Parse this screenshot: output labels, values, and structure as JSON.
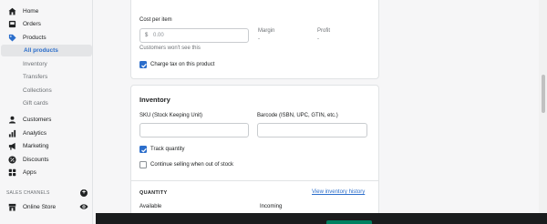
{
  "sidebar": {
    "items": [
      {
        "label": "Home",
        "icon": "home-icon"
      },
      {
        "label": "Orders",
        "icon": "orders-icon"
      },
      {
        "label": "Products",
        "icon": "tag-icon"
      },
      {
        "label": "All products",
        "active": true
      },
      {
        "label": "Inventory"
      },
      {
        "label": "Transfers"
      },
      {
        "label": "Collections"
      },
      {
        "label": "Gift cards"
      },
      {
        "label": "Customers",
        "icon": "person-icon"
      },
      {
        "label": "Analytics",
        "icon": "bar-chart-icon"
      },
      {
        "label": "Marketing",
        "icon": "megaphone-icon"
      },
      {
        "label": "Discounts",
        "icon": "discount-icon"
      },
      {
        "label": "Apps",
        "icon": "apps-icon"
      }
    ],
    "sales_channels_label": "SALES CHANNELS",
    "online_store_label": "Online Store"
  },
  "pricing": {
    "cost_label": "Cost per item",
    "cost_prefix": "$",
    "cost_value": "0.00",
    "cost_help": "Customers won't see this",
    "margin_label": "Margin",
    "margin_value": "-",
    "profit_label": "Profit",
    "profit_value": "-",
    "charge_tax_label": "Charge tax on this product",
    "charge_tax_checked": true
  },
  "inventory": {
    "title": "Inventory",
    "sku_label": "SKU (Stock Keeping Unit)",
    "barcode_label": "Barcode (ISBN, UPC, GTIN, etc.)",
    "track_quantity_label": "Track quantity",
    "track_quantity_checked": true,
    "continue_selling_label": "Continue selling when out of stock",
    "continue_selling_checked": false,
    "quantity_heading": "QUANTITY",
    "history_link": "View inventory history",
    "available_label": "Available",
    "incoming_label": "Incoming"
  },
  "colors": {
    "accent": "#2c6ecb",
    "primary_button": "#008060",
    "bottom_bar": "#1a1c1d"
  }
}
